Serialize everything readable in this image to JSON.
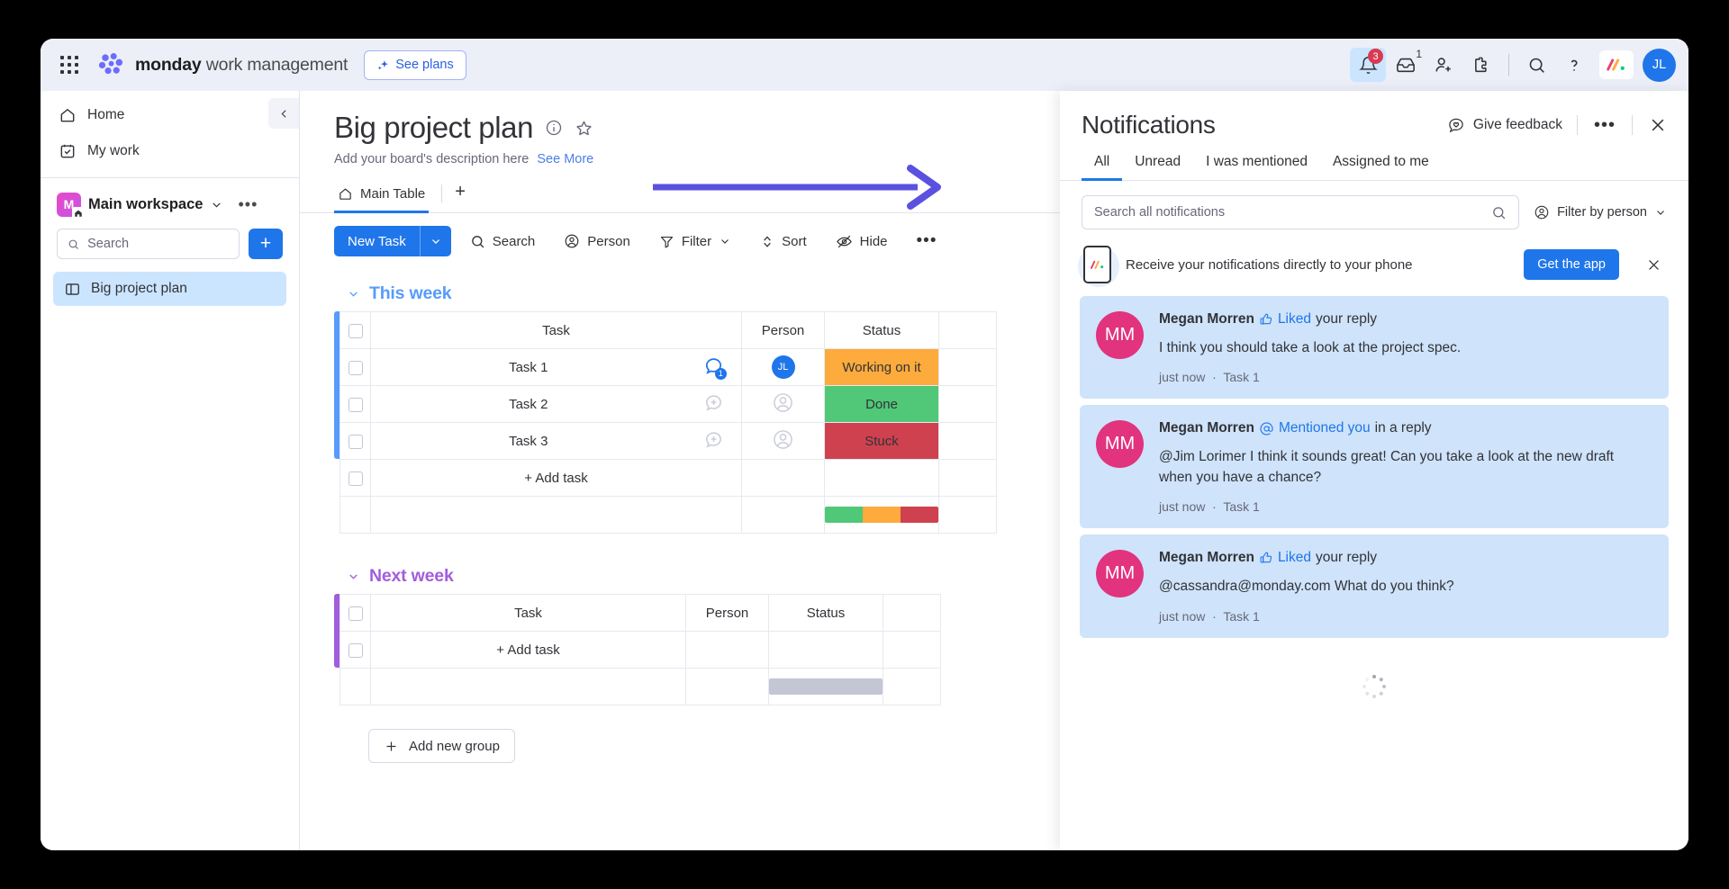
{
  "topbar": {
    "apps_icon": "apps-grid-icon",
    "brand_bold": "monday",
    "brand_light": " work management",
    "see_plans": "See plans",
    "notifications_badge": "3",
    "inbox_badge": "1",
    "avatar_initials": "JL",
    "help_label": "?"
  },
  "sidebar": {
    "nav": [
      {
        "label": "Home",
        "icon": "home-icon"
      },
      {
        "label": "My work",
        "icon": "my-work-icon"
      }
    ],
    "workspace": {
      "initial": "M",
      "name": "Main workspace"
    },
    "search_placeholder": "Search",
    "add_label": "+",
    "boards": [
      {
        "label": "Big project plan",
        "icon": "board-icon"
      }
    ]
  },
  "board": {
    "title": "Big project plan",
    "description": "Add your board's description here",
    "see_more": "See More",
    "tabs": [
      {
        "label": "Main Table"
      }
    ],
    "tab_add": "+",
    "toolbar": {
      "new_task": "New Task",
      "search": "Search",
      "person": "Person",
      "filter": "Filter",
      "sort": "Sort",
      "hide": "Hide",
      "more": "•••"
    },
    "add_new_group": "Add new group",
    "groups": [
      {
        "name": "This week",
        "color": "#579bfc",
        "columns": [
          "Task",
          "Person",
          "Status"
        ],
        "rows": [
          {
            "task": "Task 1",
            "chat_count": "1",
            "person": "JL",
            "person_filled": true,
            "status": "Working on it",
            "status_color": "#fdab3d"
          },
          {
            "task": "Task 2",
            "chat_count": "",
            "person": "",
            "person_filled": false,
            "status": "Done",
            "status_color": "#50c878"
          },
          {
            "task": "Task 3",
            "chat_count": "",
            "person": "",
            "person_filled": false,
            "status": "Stuck",
            "status_color": "#d0414f"
          }
        ],
        "add_task": "+ Add task",
        "summary": [
          {
            "color": "#50c878",
            "pct": 33.3
          },
          {
            "color": "#fdab3d",
            "pct": 33.3
          },
          {
            "color": "#d0414f",
            "pct": 33.4
          }
        ]
      },
      {
        "name": "Next week",
        "color": "#a25ddc",
        "columns": [
          "Task",
          "Person",
          "Status"
        ],
        "rows": [],
        "add_task": "+ Add task",
        "summary": [
          {
            "color": "#c3c6d4",
            "pct": 100
          }
        ]
      }
    ]
  },
  "notifications": {
    "title": "Notifications",
    "give_feedback": "Give feedback",
    "more": "•••",
    "tabs": [
      {
        "label": "All",
        "selected": true
      },
      {
        "label": "Unread",
        "selected": false
      },
      {
        "label": "I was mentioned",
        "selected": false
      },
      {
        "label": "Assigned to me",
        "selected": false
      }
    ],
    "search_placeholder": "Search all notifications",
    "filter_by_person": "Filter by person",
    "banner": {
      "text": "Receive your notifications directly to your phone",
      "cta": "Get the app"
    },
    "items": [
      {
        "initials": "MM",
        "name": "Megan Morren",
        "action": "Liked",
        "action_icon": "thumbs-up-icon",
        "suffix": "your reply",
        "text": "I think you should take a look at the project spec.",
        "time": "just now",
        "source": "Task 1"
      },
      {
        "initials": "MM",
        "name": "Megan Morren",
        "action": "Mentioned you",
        "action_icon": "at-sign-icon",
        "suffix": "in a reply",
        "text": "@Jim Lorimer I think it sounds great! Can you take a look at the new draft when you have a chance?",
        "time": "just now",
        "source": "Task 1"
      },
      {
        "initials": "MM",
        "name": "Megan Morren",
        "action": "Liked",
        "action_icon": "thumbs-up-icon",
        "suffix": "your reply",
        "text": "@cassandra@monday.com What do you think?",
        "time": "just now",
        "source": "Task 1"
      }
    ]
  },
  "annotation": {
    "arrow_color": "#5a51e0"
  },
  "colors": {
    "primary": "#1f76ea",
    "topbar_bg": "#eceff8",
    "notif_card_bg": "#cfe3fa",
    "avatar_pink": "#e2337e"
  }
}
